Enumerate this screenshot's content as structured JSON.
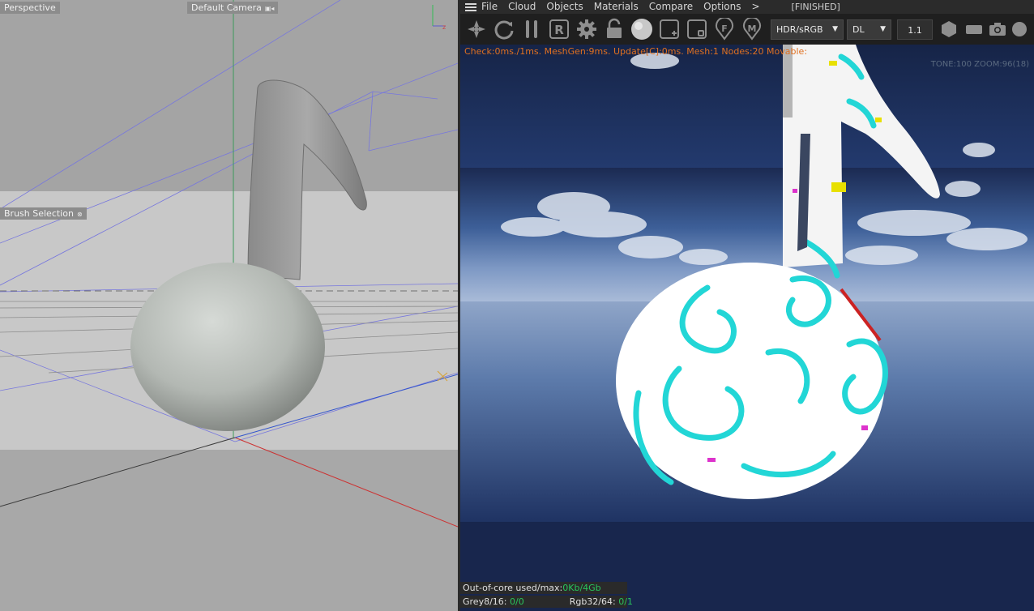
{
  "viewport": {
    "view_label": "Perspective",
    "camera_label": "Default Camera",
    "brush_label": "Brush Selection"
  },
  "render": {
    "menu": [
      "File",
      "Cloud",
      "Objects",
      "Materials",
      "Compare",
      "Options",
      ">"
    ],
    "status": "[FINISHED]",
    "toolbar": {
      "color_space": "HDR/sRGB",
      "kernel": "DL",
      "value": "1.1",
      "buttons": [
        "reset-icon",
        "refresh-icon",
        "pause-icon",
        "region-r-icon",
        "settings-gear-icon",
        "unlock-icon",
        "sphere-icon",
        "add-region-icon",
        "focus-icon",
        "focus-f-icon",
        "material-m-icon",
        "hexagon-icon",
        "rect-icon",
        "camera-icon",
        "circle-icon"
      ]
    },
    "stats_line": "Check:0ms./1ms. MeshGen:9ms. Update[C]:0ms. Mesh:1 Nodes:20 Movable:",
    "stats_right": "TONE:100 ZOOM:96(18)",
    "out_of_core_label": "Out-of-core used/max:",
    "out_of_core_value": "0Kb/4Gb",
    "grey_label": "Grey8/16: ",
    "grey_value": "0/0",
    "rgb_label": "Rgb32/64: ",
    "rgb_value": "0/1"
  },
  "colors": {
    "accent_orange": "#e07020",
    "green_value": "#29c45c",
    "viewport_grid_blue": "#7777dd"
  }
}
